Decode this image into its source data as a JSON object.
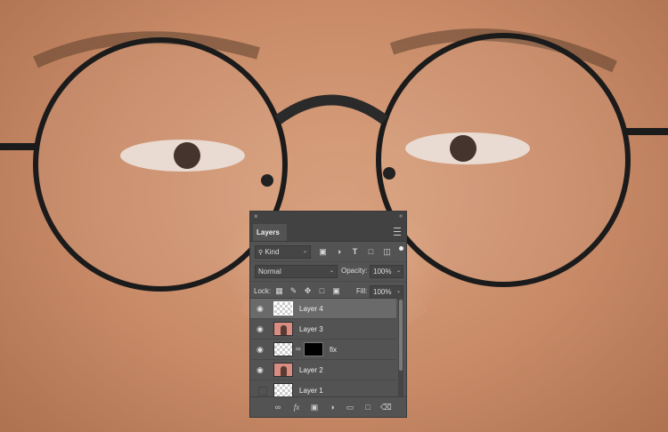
{
  "panel": {
    "close_glyph": "×",
    "collapse_glyph": "«",
    "tab_label": "Layers",
    "filter": {
      "label": "Kind",
      "icons": [
        "image-filter-icon",
        "adjustment-filter-icon",
        "type-filter-icon",
        "shape-filter-icon",
        "smart-object-filter-icon"
      ]
    },
    "blend_mode": "Normal",
    "opacity_label": "Opacity:",
    "opacity_value": "100%",
    "lock_label": "Lock:",
    "fill_label": "Fill:",
    "fill_value": "100%",
    "layers": [
      {
        "name": "Layer 4",
        "visible": true,
        "selected": true,
        "thumb": "transparent"
      },
      {
        "name": "Layer 3",
        "visible": true,
        "selected": false,
        "thumb": "photo"
      },
      {
        "name": "fix",
        "visible": true,
        "selected": false,
        "thumb": "transparent",
        "mask": true
      },
      {
        "name": "Layer 2",
        "visible": true,
        "selected": false,
        "thumb": "photo"
      },
      {
        "name": "Layer 1",
        "visible": false,
        "selected": false,
        "thumb": "transparent"
      }
    ],
    "bottom_icons": [
      "link-icon",
      "fx-icon",
      "layer-mask-icon",
      "adjustment-layer-icon",
      "group-folder-icon",
      "new-layer-icon",
      "trash-icon"
    ],
    "fx_label": "fx"
  },
  "colors": {
    "panel_bg": "#535353",
    "selected_row": "#6a6a6a",
    "skin": "#c98b68"
  }
}
